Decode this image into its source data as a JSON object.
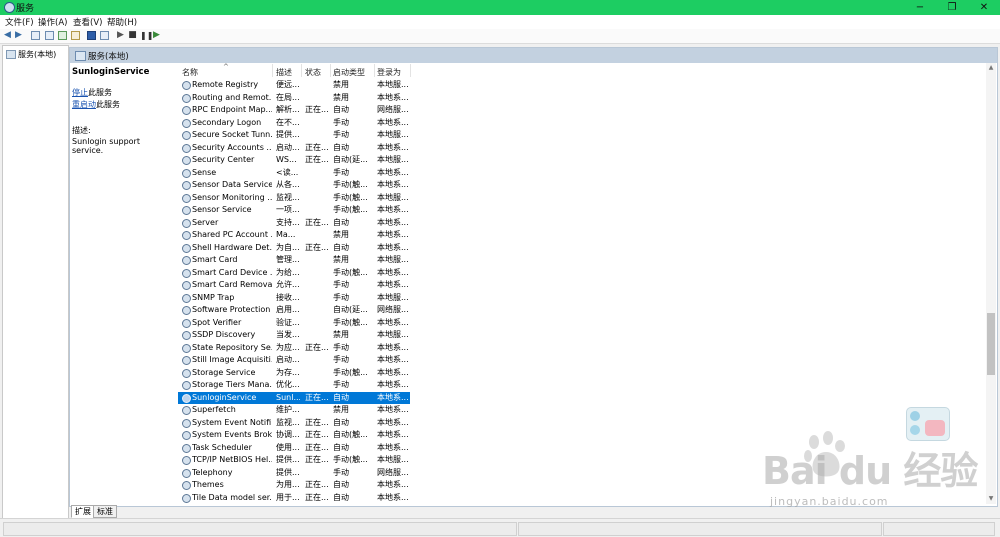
{
  "window": {
    "title": "服务",
    "minimize": "−",
    "restore": "❐",
    "close": "✕"
  },
  "menu": [
    "文件(F)",
    "操作(A)",
    "查看(V)",
    "帮助(H)"
  ],
  "toolbar": {
    "icons": [
      "back-icon",
      "forward-icon",
      "console-tree-icon",
      "properties-icon",
      "refresh-icon",
      "export-list-icon",
      "help-icon",
      "view-icon",
      "start-icon",
      "stop-icon",
      "pause-icon",
      "restart-icon"
    ]
  },
  "tree": {
    "root_label": "服务(本地)"
  },
  "pane": {
    "title": "服务(本地)"
  },
  "details": {
    "service_name": "SunloginService",
    "stop_link": "停止",
    "stop_suffix": "此服务",
    "restart_link": "重启动",
    "restart_suffix": "此服务",
    "desc_label": "描述:",
    "desc_text": "Sunlogin support service."
  },
  "table": {
    "columns": [
      "名称",
      "描述",
      "状态",
      "启动类型",
      "登录为"
    ],
    "sort_indicator": "^",
    "rows": [
      [
        "Remote Registry",
        "便远...",
        "",
        "禁用",
        "本地服..."
      ],
      [
        "Routing and Remot...",
        "在局...",
        "",
        "禁用",
        "本地系..."
      ],
      [
        "RPC Endpoint Map...",
        "解析...",
        "正在...",
        "自动",
        "网络服..."
      ],
      [
        "Secondary Logon",
        "在不...",
        "",
        "手动",
        "本地系..."
      ],
      [
        "Secure Socket Tunn...",
        "提供...",
        "",
        "手动",
        "本地服..."
      ],
      [
        "Security Accounts ...",
        "启动...",
        "正在...",
        "自动",
        "本地系..."
      ],
      [
        "Security Center",
        "WS...",
        "正在...",
        "自动(延...",
        "本地服..."
      ],
      [
        "Sense",
        "<读...",
        "",
        "手动",
        "本地系..."
      ],
      [
        "Sensor Data Service",
        "从各...",
        "",
        "手动(触...",
        "本地系..."
      ],
      [
        "Sensor Monitoring ...",
        "监视...",
        "",
        "手动(触...",
        "本地服..."
      ],
      [
        "Sensor Service",
        "一项...",
        "",
        "手动(触...",
        "本地系..."
      ],
      [
        "Server",
        "支持...",
        "正在...",
        "自动",
        "本地系..."
      ],
      [
        "Shared PC Account ...",
        "Ma...",
        "",
        "禁用",
        "本地系..."
      ],
      [
        "Shell Hardware Det...",
        "为自...",
        "正在...",
        "自动",
        "本地系..."
      ],
      [
        "Smart Card",
        "管理...",
        "",
        "禁用",
        "本地服..."
      ],
      [
        "Smart Card Device ...",
        "为给...",
        "",
        "手动(触...",
        "本地系..."
      ],
      [
        "Smart Card Remova...",
        "允许...",
        "",
        "手动",
        "本地系..."
      ],
      [
        "SNMP Trap",
        "接收...",
        "",
        "手动",
        "本地服..."
      ],
      [
        "Software Protection",
        "启用...",
        "",
        "自动(延...",
        "网络服..."
      ],
      [
        "Spot Verifier",
        "验证...",
        "",
        "手动(触...",
        "本地系..."
      ],
      [
        "SSDP Discovery",
        "当发...",
        "",
        "禁用",
        "本地服..."
      ],
      [
        "State Repository Se...",
        "为应...",
        "正在...",
        "手动",
        "本地系..."
      ],
      [
        "Still Image Acquisiti...",
        "启动...",
        "",
        "手动",
        "本地系..."
      ],
      [
        "Storage Service",
        "为存...",
        "",
        "手动(触...",
        "本地系..."
      ],
      [
        "Storage Tiers Mana...",
        "优化...",
        "",
        "手动",
        "本地系..."
      ],
      [
        "SunloginService",
        "Sunl...",
        "正在...",
        "自动",
        "本地系..."
      ],
      [
        "Superfetch",
        "维护...",
        "",
        "禁用",
        "本地系..."
      ],
      [
        "System Event Notifi...",
        "监视...",
        "正在...",
        "自动",
        "本地系..."
      ],
      [
        "System Events Broker",
        "协调...",
        "正在...",
        "自动(触...",
        "本地系..."
      ],
      [
        "Task Scheduler",
        "使用...",
        "正在...",
        "自动",
        "本地系..."
      ],
      [
        "TCP/IP NetBIOS Hel...",
        "提供...",
        "正在...",
        "手动(触...",
        "本地服..."
      ],
      [
        "Telephony",
        "提供...",
        "",
        "手动",
        "网络服..."
      ],
      [
        "Themes",
        "为用...",
        "正在...",
        "自动",
        "本地系..."
      ],
      [
        "Tile Data model ser...",
        "用于...",
        "正在...",
        "自动",
        "本地系..."
      ]
    ],
    "selected_index": 25
  },
  "tabs": [
    "扩展",
    "标准"
  ],
  "watermark": {
    "logo": "Bai du 经验",
    "url": "jingyan.baidu.com"
  },
  "colors": {
    "titlebar": "#1dcd62",
    "selection": "#0078d7",
    "link": "#1a53b0"
  }
}
